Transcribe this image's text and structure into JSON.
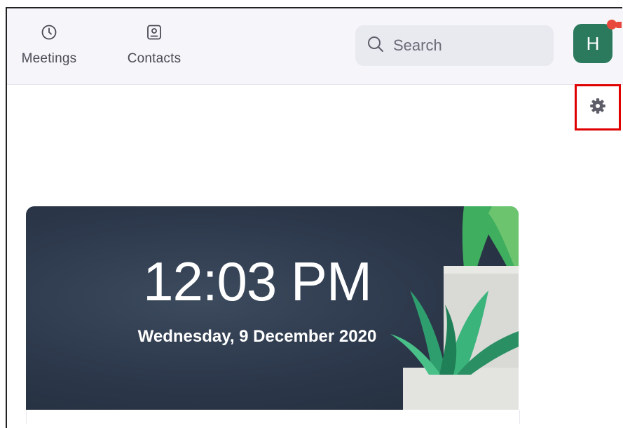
{
  "nav": {
    "meetings_label": "Meetings",
    "contacts_label": "Contacts"
  },
  "search": {
    "placeholder": "Search"
  },
  "profile": {
    "initial": "H"
  },
  "clock": {
    "time": "12:03 PM",
    "date": "Wednesday, 9 December 2020"
  },
  "colors": {
    "avatar_bg": "#2b7a5e",
    "notification": "#e8483b",
    "highlight": "#e00000",
    "card_bg": "#2e3a4d",
    "plant_green": "#33b07a"
  },
  "icons": {
    "meetings": "clock-icon",
    "contacts": "contact-card-icon",
    "search": "search-icon",
    "settings": "gear-icon"
  }
}
